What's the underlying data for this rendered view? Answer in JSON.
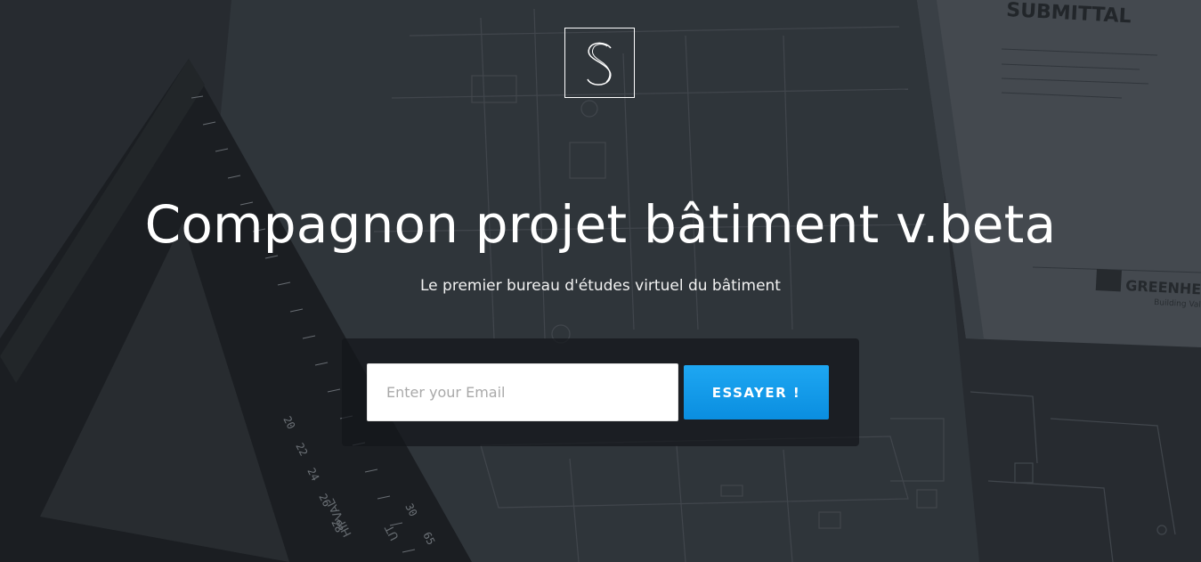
{
  "brand": {
    "logo_letter": "S",
    "icon": "s-monogram-logo"
  },
  "hero": {
    "title": "Compagnon projet bâtiment v.beta",
    "subtitle": "Le premier bureau d'études virtuel du bâtiment"
  },
  "signup": {
    "email_placeholder": "Enter your Email",
    "email_value": "",
    "submit_label": "ESSAYER !"
  },
  "background": {
    "submittal_stamp": "SUBMITTAL",
    "company_mark": "GREENHE",
    "company_tagline": "Building Valu",
    "ruler_numbers": [
      "20",
      "22",
      "24",
      "26",
      "28",
      "30",
      "65"
    ],
    "ruler_brand": "HIPVAL",
    "ruler_text": "UT"
  },
  "colors": {
    "accent": "#0a97ea",
    "background": "#2b2f35",
    "panel": "#15171a"
  }
}
